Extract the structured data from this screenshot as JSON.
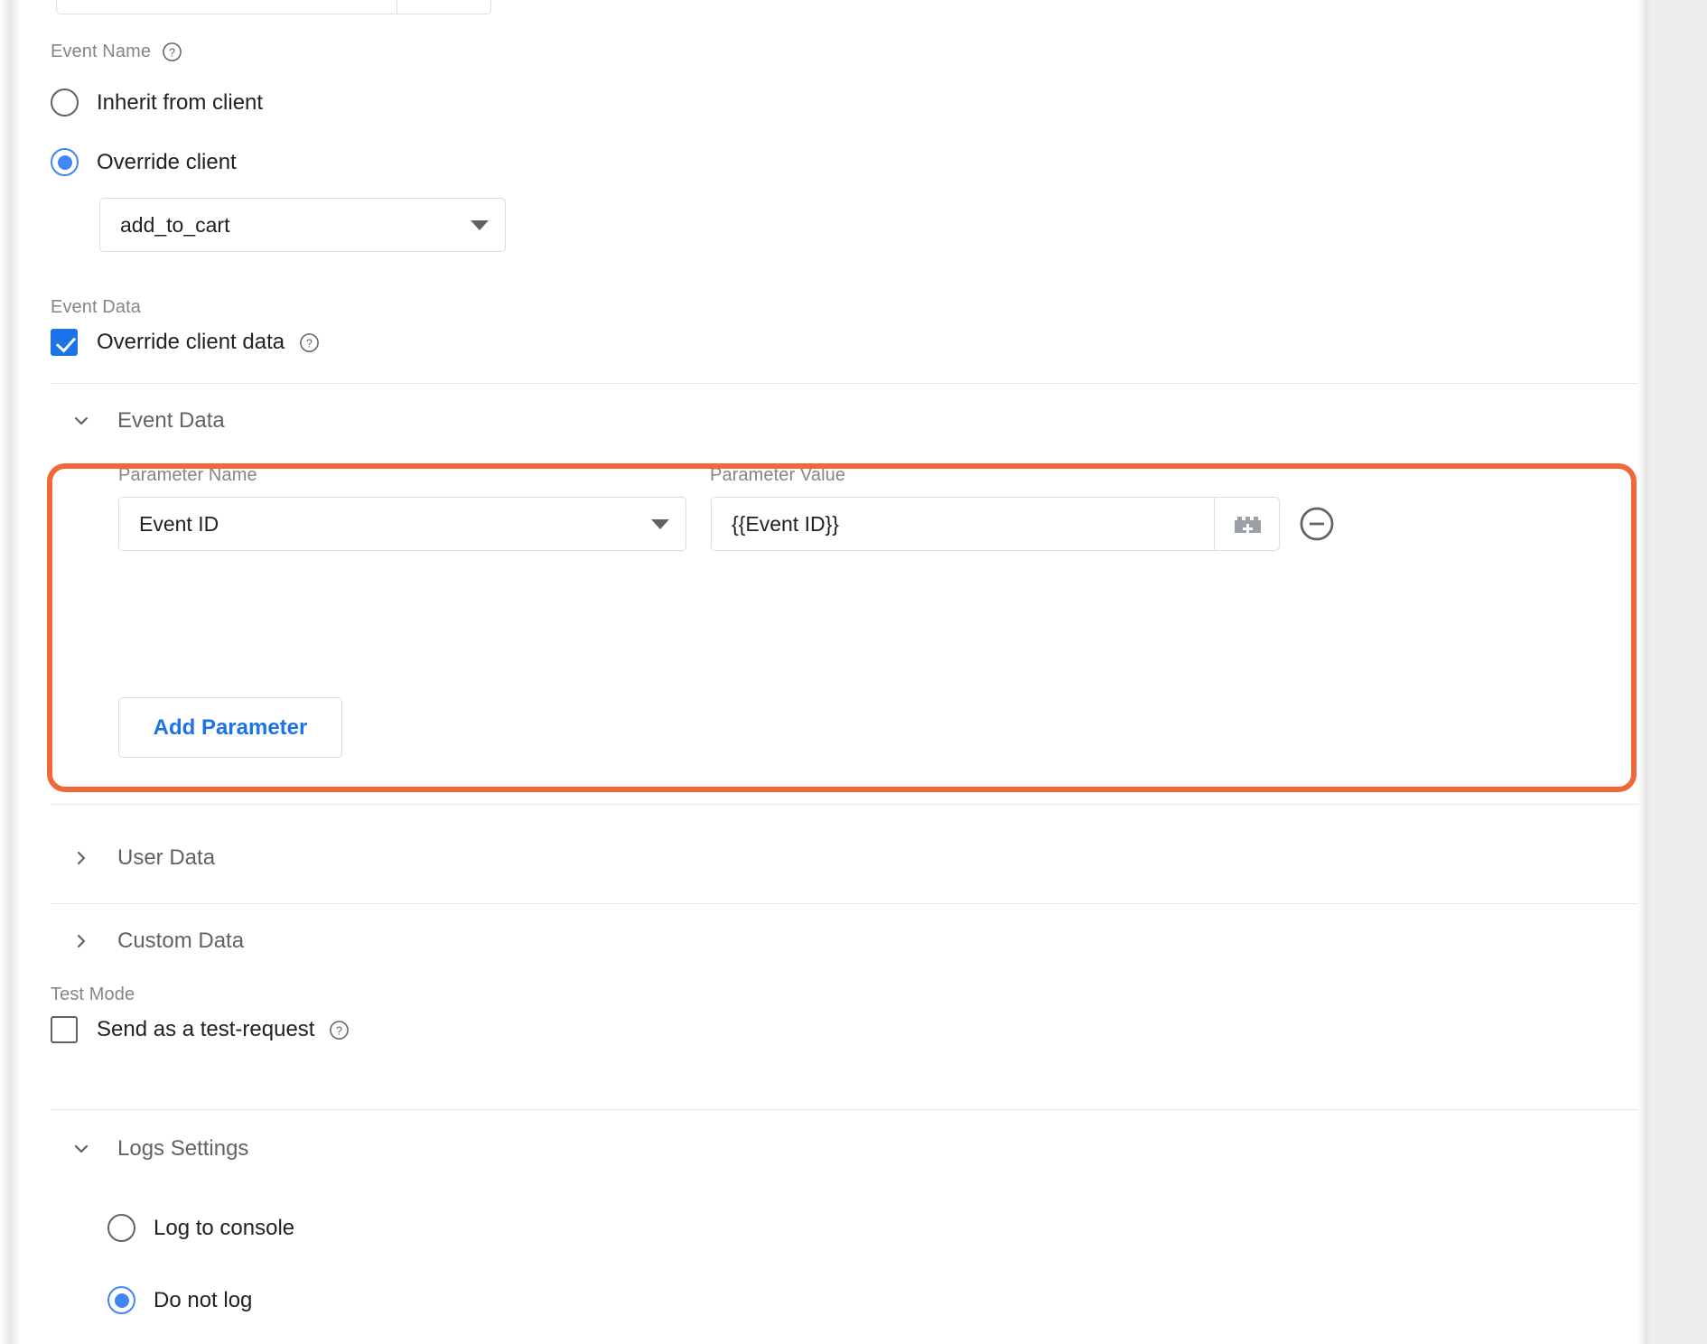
{
  "event_name": {
    "label": "Event Name",
    "help_icon": "help-circle-icon",
    "options": [
      {
        "label": "Inherit from client",
        "selected": false
      },
      {
        "label": "Override client",
        "selected": true
      }
    ],
    "override_select_value": "add_to_cart"
  },
  "event_data_toggle": {
    "label": "Event Data",
    "checkbox_label": "Override client data",
    "checked": true,
    "help_icon": "help-circle-icon"
  },
  "event_data_section": {
    "title": "Event Data",
    "expanded": true,
    "chevron_icon": "chevron-down-icon",
    "columns": {
      "parameter_name": "Parameter Name",
      "parameter_value": "Parameter Value"
    },
    "rows": [
      {
        "parameter_name": "Event ID",
        "parameter_value": "{{Event ID}}",
        "variable_picker_icon": "lego-brick-plus-icon",
        "remove_icon": "minus-circle-icon"
      }
    ],
    "add_parameter_label": "Add Parameter",
    "highlight_color": "#f0683a"
  },
  "user_data_section": {
    "title": "User Data",
    "expanded": false,
    "chevron_icon": "chevron-right-icon"
  },
  "custom_data_section": {
    "title": "Custom Data",
    "expanded": false,
    "chevron_icon": "chevron-right-icon"
  },
  "test_mode": {
    "label": "Test Mode",
    "checkbox_label": "Send as a test-request",
    "checked": false,
    "help_icon": "help-circle-icon"
  },
  "logs_settings": {
    "title": "Logs Settings",
    "expanded": true,
    "chevron_icon": "chevron-down-icon",
    "options": [
      {
        "label": "Log to console",
        "selected": false
      },
      {
        "label": "Do not log",
        "selected": true
      }
    ]
  },
  "colors": {
    "accent_blue": "#1a73e8",
    "radio_blue": "#4285f4",
    "highlight_orange": "#f0683a",
    "text_primary": "#202124",
    "text_secondary": "#5f6368",
    "border": "#dadce0"
  }
}
